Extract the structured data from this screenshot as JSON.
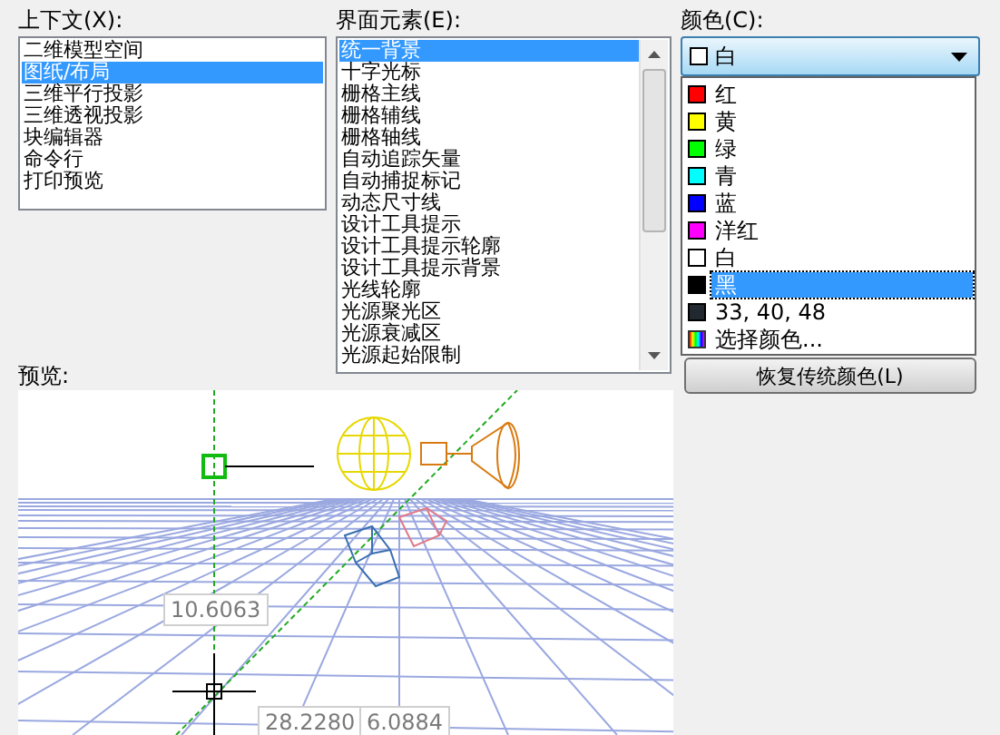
{
  "context": {
    "label": "上下文(X):",
    "items": [
      {
        "label": "二维模型空间",
        "selected": false
      },
      {
        "label": "图纸/布局",
        "selected": true
      },
      {
        "label": "三维平行投影",
        "selected": false
      },
      {
        "label": "三维透视投影",
        "selected": false
      },
      {
        "label": "块编辑器",
        "selected": false
      },
      {
        "label": "命令行",
        "selected": false
      },
      {
        "label": "打印预览",
        "selected": false
      }
    ]
  },
  "interface_elements": {
    "label": "界面元素(E):",
    "items": [
      {
        "label": "统一背景",
        "selected": true
      },
      {
        "label": "十字光标",
        "selected": false
      },
      {
        "label": "栅格主线",
        "selected": false
      },
      {
        "label": "栅格辅线",
        "selected": false
      },
      {
        "label": "栅格轴线",
        "selected": false
      },
      {
        "label": "自动追踪矢量",
        "selected": false
      },
      {
        "label": "自动捕捉标记",
        "selected": false
      },
      {
        "label": "动态尺寸线",
        "selected": false
      },
      {
        "label": "设计工具提示",
        "selected": false
      },
      {
        "label": "设计工具提示轮廓",
        "selected": false
      },
      {
        "label": "设计工具提示背景",
        "selected": false
      },
      {
        "label": "光线轮廓",
        "selected": false
      },
      {
        "label": "光源聚光区",
        "selected": false
      },
      {
        "label": "光源衰减区",
        "selected": false
      },
      {
        "label": "光源起始限制",
        "selected": false
      }
    ]
  },
  "color": {
    "label": "颜色(C):",
    "value": {
      "label": "白",
      "color": "#ffffff"
    },
    "options": [
      {
        "kind": "swatch",
        "label": "红",
        "color": "#ff0000",
        "selected": false
      },
      {
        "kind": "swatch",
        "label": "黄",
        "color": "#ffff00",
        "selected": false
      },
      {
        "kind": "swatch",
        "label": "绿",
        "color": "#00ff00",
        "selected": false
      },
      {
        "kind": "swatch",
        "label": "青",
        "color": "#00ffff",
        "selected": false
      },
      {
        "kind": "swatch",
        "label": "蓝",
        "color": "#0000ff",
        "selected": false
      },
      {
        "kind": "swatch",
        "label": "洋红",
        "color": "#ff00ff",
        "selected": false
      },
      {
        "kind": "swatch",
        "label": "白",
        "color": "#ffffff",
        "selected": false
      },
      {
        "kind": "swatch",
        "label": "黑",
        "color": "#000000",
        "selected": true
      },
      {
        "kind": "swatch",
        "label": "33, 40, 48",
        "color": "#212830",
        "selected": false
      },
      {
        "kind": "picker",
        "label": "选择颜色...",
        "selected": false
      }
    ]
  },
  "restore_button": {
    "label": "恢复传统颜色(L)"
  },
  "preview": {
    "label": "预览:",
    "readouts": [
      "10.6063",
      "28.2280",
      "6.0884"
    ]
  }
}
